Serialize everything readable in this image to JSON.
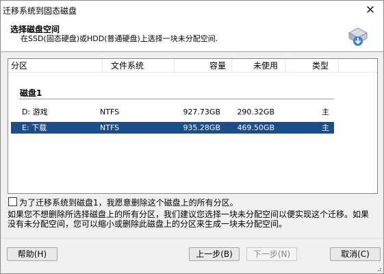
{
  "window": {
    "title": "迁移系统到固态磁盘"
  },
  "header": {
    "heading": "选择磁盘空间",
    "subheading": "在SSD(固态硬盘)或HDD(普通硬盘)上选择一块未分配空间."
  },
  "table": {
    "columns": [
      "分区",
      "文件系统",
      "容量",
      "未使用",
      "类型"
    ],
    "disk_label": "磁盘1",
    "rows": [
      {
        "partition": "D: 游戏",
        "fs": "NTFS",
        "capacity": "927.73GB",
        "unused": "290.32GB",
        "type": "主",
        "selected": false
      },
      {
        "partition": "E: 下载",
        "fs": "NTFS",
        "capacity": "935.28GB",
        "unused": "469.50GB",
        "type": "主",
        "selected": true
      }
    ]
  },
  "confirm": {
    "checked": false,
    "label": "为了迁移系统到磁盘1，我愿意删除这个磁盘上的所有分区。"
  },
  "note": {
    "line1": "如果您不想删除所选择磁盘上的所有分区，我们建议您选择一块未分配空间以便实现这个迁移。如果",
    "line2": "没有未分配空间，您可以缩小或删除此磁盘上的分区来生成一块未分配空间。"
  },
  "buttons": {
    "help": "帮助(H)",
    "prev": "上一步(B)",
    "next": "下一步(N)",
    "cancel": "取消(C)"
  },
  "colors": {
    "selection": "#1a4e8a"
  }
}
